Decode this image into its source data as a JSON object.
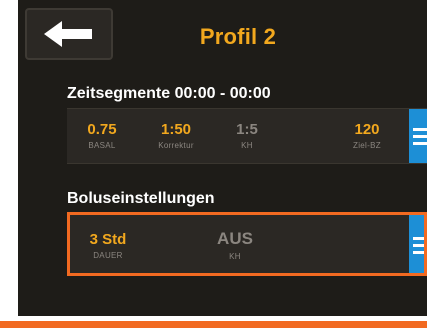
{
  "header": {
    "title": "Profil 2",
    "back_icon": "arrow-left-icon"
  },
  "segments": {
    "title": "Zeitsegmente 00:00 - 00:00",
    "cells": [
      {
        "value": "0.75",
        "label": "BASAL"
      },
      {
        "value": "1:50",
        "label": "Korrektur"
      },
      {
        "value": "1:5",
        "label": "KH"
      },
      {
        "value": "120",
        "label": "Ziel-BZ"
      }
    ]
  },
  "bolus": {
    "title": "Boluseinstellungen",
    "cells": [
      {
        "value": "3 Std",
        "label": "DAUER"
      },
      {
        "value": "AUS",
        "label": "KH"
      }
    ]
  },
  "colors": {
    "accent_orange": "#f26a21",
    "value_yellow": "#f2a81e",
    "menu_blue": "#1d8fd6",
    "background": "#1e1c18"
  }
}
